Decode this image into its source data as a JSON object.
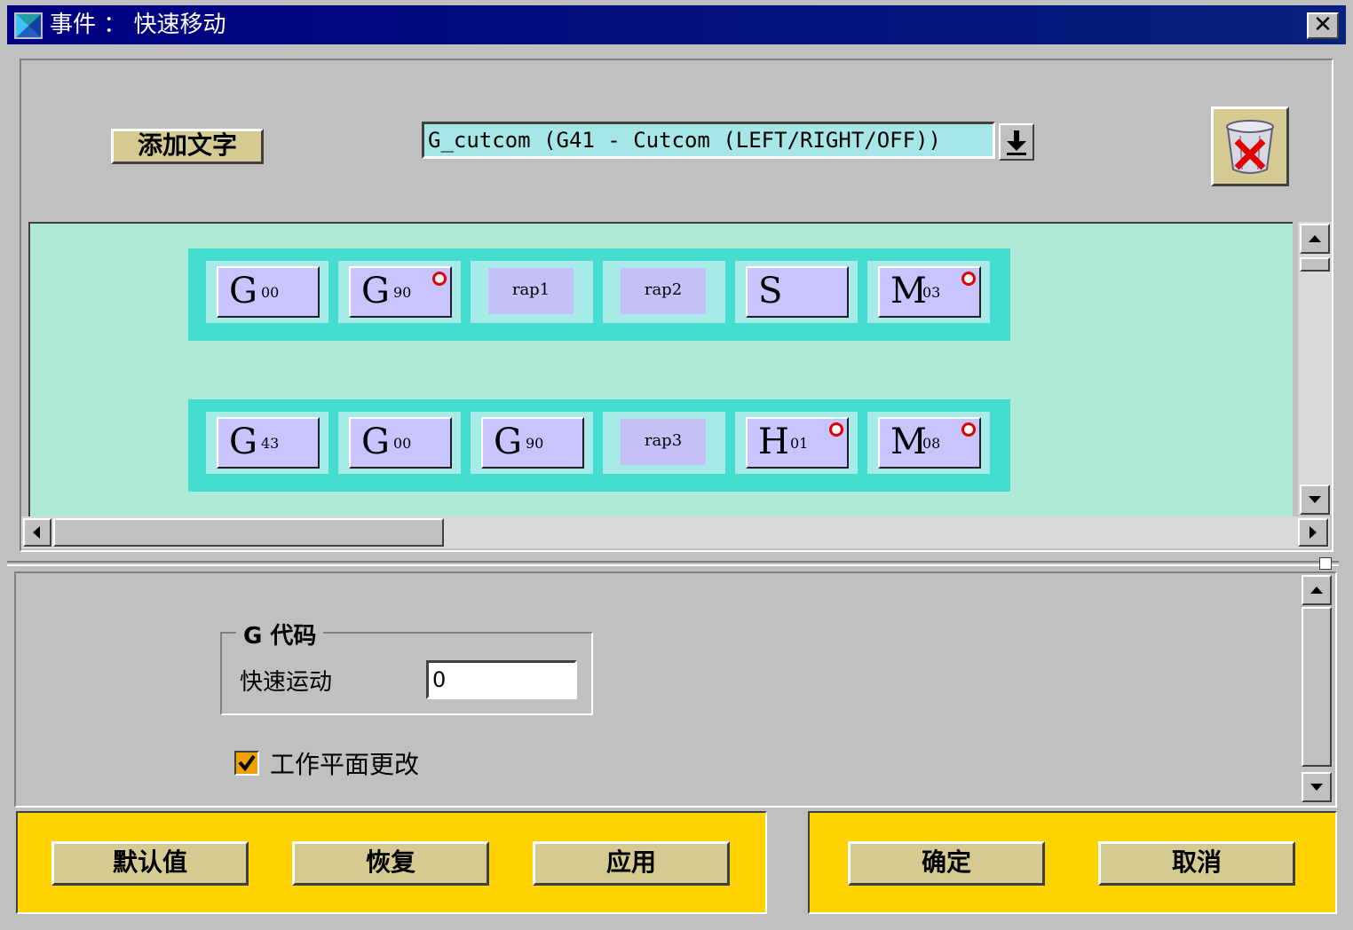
{
  "window": {
    "title": "事件 ： 快速移动",
    "close_label": "✕"
  },
  "toolbar": {
    "add_text_label": "添加文字",
    "combo_value": "G_cutcom (G41 - Cutcom (LEFT/RIGHT/OFF))",
    "trash_icon": "trash-delete-icon"
  },
  "blocks": {
    "row1": [
      {
        "main": "G",
        "sub": "00",
        "dot": false,
        "type": "word"
      },
      {
        "main": "G",
        "sub": "90",
        "dot": true,
        "type": "word"
      },
      {
        "label": "rap1",
        "type": "flat"
      },
      {
        "label": "rap2",
        "type": "flat"
      },
      {
        "main": "S",
        "sub": "",
        "dot": false,
        "type": "word"
      },
      {
        "main": "M",
        "sub": "03",
        "dot": true,
        "type": "word"
      }
    ],
    "row2": [
      {
        "main": "G",
        "sub": "43",
        "dot": false,
        "type": "word"
      },
      {
        "main": "G",
        "sub": "00",
        "dot": false,
        "type": "word"
      },
      {
        "main": "G",
        "sub": "90",
        "dot": false,
        "type": "word"
      },
      {
        "label": "rap3",
        "type": "flat"
      },
      {
        "main": "H",
        "sub": "01",
        "dot": true,
        "type": "word"
      },
      {
        "main": "M",
        "sub": "08",
        "dot": true,
        "type": "word"
      }
    ]
  },
  "gcode_group": {
    "title": "G 代码",
    "rapid_label": "快速运动",
    "rapid_value": "0"
  },
  "workplane": {
    "label": "工作平面更改",
    "checked": true
  },
  "buttons": {
    "default": "默认值",
    "restore": "恢复",
    "apply": "应用",
    "ok": "确定",
    "cancel": "取消"
  },
  "colors": {
    "title_bg": "#000080",
    "canvas_bg": "#ade9d4",
    "row_bg": "#44ddd0",
    "block_bg": "#c8c4ff",
    "button_bar": "#ffd200",
    "button_face": "#d4ca92"
  }
}
